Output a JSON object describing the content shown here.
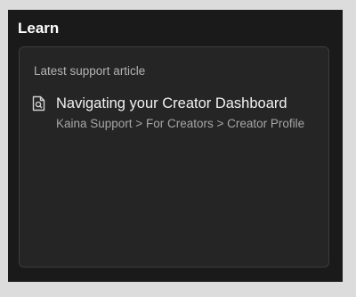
{
  "panel": {
    "title": "Learn"
  },
  "card": {
    "label": "Latest support article",
    "article": {
      "icon": "document-search-icon",
      "title": "Navigating your Creator Dashboard",
      "path": "Kaina Support > For Creators > Creator Profile"
    }
  },
  "colors": {
    "panel_background": "#1a1a1a",
    "card_background": "#252525",
    "card_border": "#3c3c3c",
    "page_background": "#dcdcdc"
  }
}
